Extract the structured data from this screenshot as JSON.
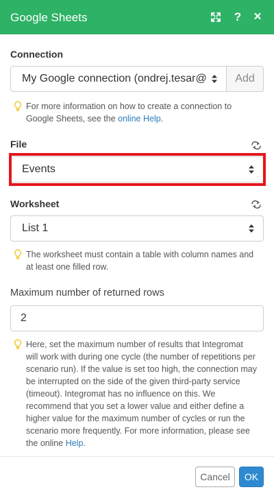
{
  "header": {
    "title": "Google Sheets",
    "background": "#2db266",
    "icons": [
      "expand-icon",
      "help-icon",
      "close-icon"
    ],
    "help_glyph": "?",
    "close_glyph": "×"
  },
  "connection": {
    "label": "Connection",
    "selected": "My Google connection (ondrej.tesar@",
    "add_label": "Add",
    "hint_before": "For more information on how to create a connection to Google Sheets, see the ",
    "hint_link": "online Help",
    "hint_after": "."
  },
  "file": {
    "label": "File",
    "selected": "Events",
    "highlight_color": "#e4161c"
  },
  "worksheet": {
    "label": "Worksheet",
    "selected": "List 1",
    "hint": "The worksheet must contain a table with column names and at least one filled row."
  },
  "max_rows": {
    "label": "Maximum number of returned rows",
    "value": "2",
    "hint_before": "Here, set the maximum number of results that Integromat will work with during one cycle (the number of repetitions per scenario run). If the value is set too high, the connection may be interrupted on the side of the given third-party service (timeout). Integromat has no influence on this. We recommend that you set a lower value and either define a higher value for the maximum number of cycles or run the scenario more frequently. For more information, please see the online ",
    "hint_link": "Help",
    "hint_after": "."
  },
  "footer": {
    "cancel_label": "Cancel",
    "ok_label": "OK",
    "ok_color": "#2e8ad0"
  },
  "colors": {
    "link": "#2a7bb8",
    "bulb": "#f0c419"
  }
}
